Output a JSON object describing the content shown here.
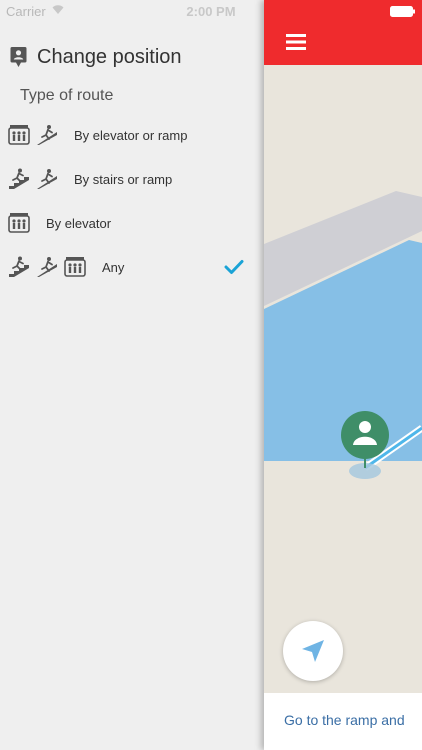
{
  "status_bar": {
    "carrier": "Carrier",
    "time": "2:00 PM"
  },
  "drawer": {
    "header_title": "Change position",
    "section_label": "Type of route",
    "routes": [
      {
        "label": "By elevator or ramp",
        "icons": [
          "elevator-icon",
          "ramp-icon"
        ],
        "selected": false
      },
      {
        "label": "By stairs or ramp",
        "icons": [
          "stairs-icon",
          "ramp-icon"
        ],
        "selected": false
      },
      {
        "label": "By elevator",
        "icons": [
          "elevator-icon"
        ],
        "selected": false
      },
      {
        "label": "Any",
        "icons": [
          "stairs-icon",
          "ramp-icon",
          "elevator-icon"
        ],
        "selected": true
      }
    ]
  },
  "map": {
    "bottom_text": "Go to the ramp and"
  },
  "colors": {
    "appbar_red": "#ef2b2d",
    "check_blue": "#1aa3d6",
    "marker_green": "#3f8e68",
    "floor_blue": "#86bfe6",
    "link_blue": "#3a6ea5"
  }
}
